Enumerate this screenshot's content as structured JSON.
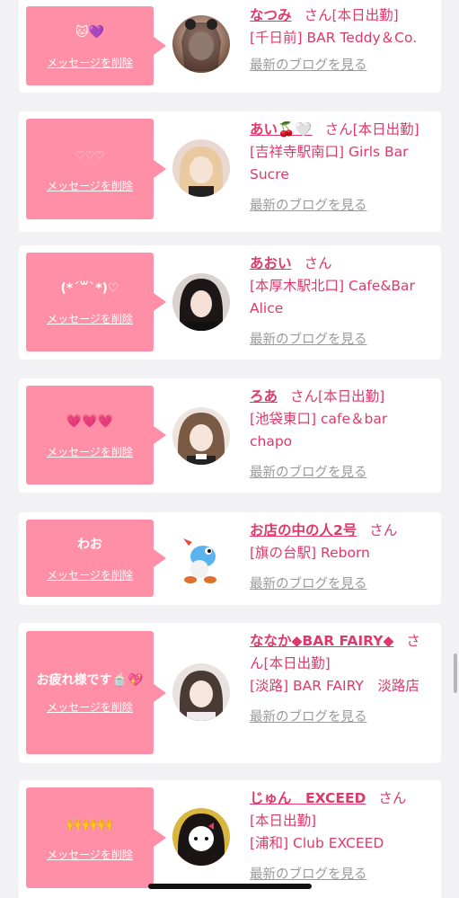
{
  "delete_label": "メッセージを削除",
  "blog_label": "最新のブログを見る",
  "san_suffix": "さん",
  "cards": [
    {
      "message": "🐱💜",
      "name": "なつみ",
      "status": "[本日出勤]",
      "shop": "[千日前] BAR Teddy＆Co."
    },
    {
      "message": "♡♡♡",
      "name": "あい🍒🤍",
      "status": "[本日出勤]",
      "shop": "[吉祥寺駅南口] Girls Bar Sucre"
    },
    {
      "message": "(*´꒳`*)♡",
      "name": "あおい",
      "status": "",
      "shop": "[本厚木駅北口] Cafe&Bar Alice"
    },
    {
      "message": "💗💗💗",
      "name": "ろあ",
      "status": "[本日出勤]",
      "shop": "[池袋東口] cafe＆bar chapo"
    },
    {
      "message": "わお",
      "name": "お店の中の人2号",
      "status": "",
      "shop": "[旗の台駅] Reborn"
    },
    {
      "message": "お疲れ様です🍵💖",
      "name": "ななか◆BAR FAIRY◆",
      "status": "[本日出勤]",
      "shop": "[淡路] BAR FAIRY　淡路店"
    },
    {
      "message": "🙌🙌🙌",
      "name": "じゅん　EXCEED",
      "status": "[本日出勤]",
      "shop": "[浦和] Club EXCEED"
    }
  ],
  "colors": {
    "bubble": "#ff8fa6",
    "accent": "#e0386a",
    "muted_link": "#9a9a9a",
    "background": "#f2f2f4"
  }
}
